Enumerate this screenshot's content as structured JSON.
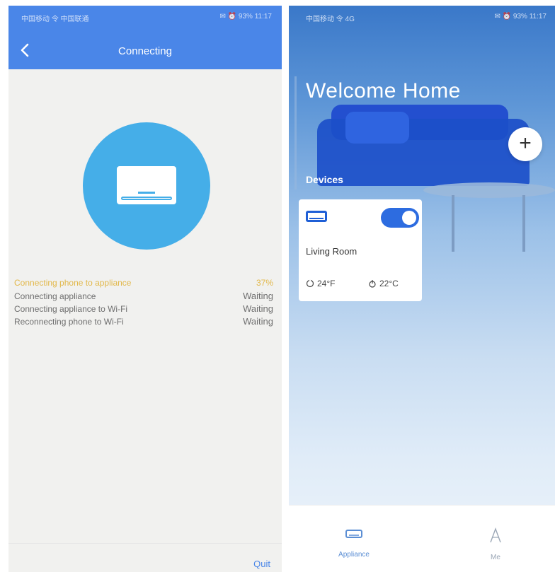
{
  "left_screen": {
    "status_left": "中国移动 令 中国联通",
    "status_right": "✉ ⏰ 93% 11:17",
    "header_title": "Connecting",
    "steps": [
      {
        "label": "Connecting phone to appliance",
        "status": "37%"
      },
      {
        "label": "Connecting appliance",
        "status": "Waiting"
      },
      {
        "label": "Connecting appliance to Wi-Fi",
        "status": "Waiting"
      },
      {
        "label": "Reconnecting phone to Wi-Fi",
        "status": "Waiting"
      }
    ],
    "quit_label": "Quit"
  },
  "right_screen": {
    "status_left": "中国移动 令 4G",
    "status_right": "✉ ⏰ 93% 11:17",
    "welcome_title": "Welcome Home",
    "add_icon": "+",
    "section_label": "Devices",
    "device": {
      "name": "Living Room",
      "indoor_temp": "24°F",
      "set_temp": "22°C",
      "power_on": true
    },
    "nav": [
      {
        "label": "Appliance",
        "active": true
      },
      {
        "label": "Me",
        "active": false
      }
    ]
  },
  "colors": {
    "header_blue": "#4a86e8",
    "circle_blue": "#45aee8",
    "progress_yellow": "#e2b84a",
    "toggle_blue": "#2d6ce0"
  }
}
